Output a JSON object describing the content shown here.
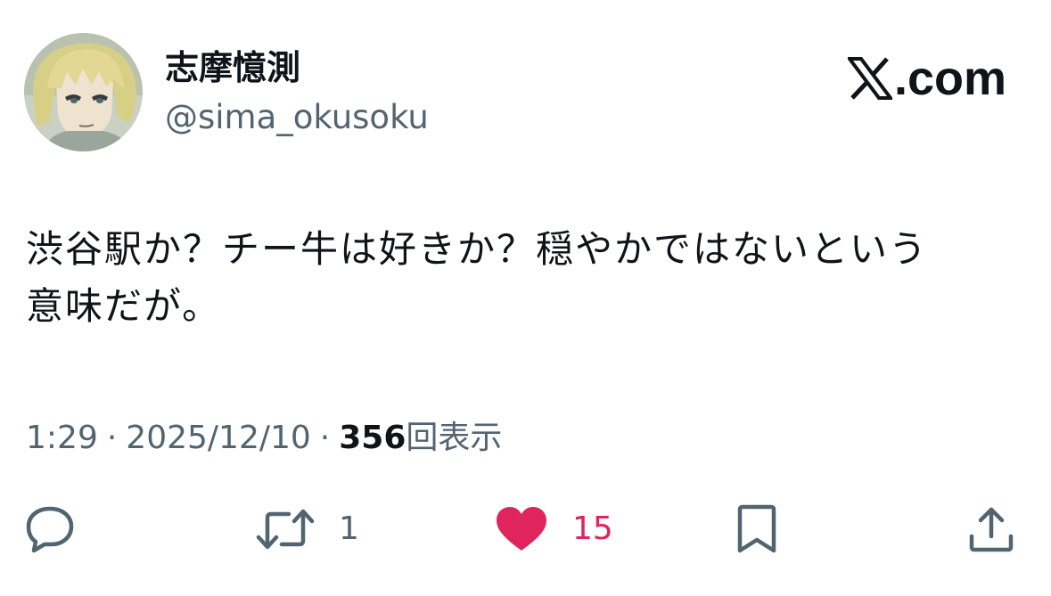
{
  "user": {
    "display_name": "志摩憶測",
    "handle": "@sima_okusoku",
    "avatar_icon": "avatar-anime-character"
  },
  "brand": {
    "text": ".com",
    "icon": "x-logo-icon"
  },
  "tweet": {
    "text_line1": "渋谷駅か？チー牛は好きか？穏やかではないという",
    "text_line2": "意味だが。"
  },
  "meta": {
    "time": "1:29",
    "date": "2025/12/10",
    "separator": "·",
    "views_count": "356",
    "views_label": "回表示"
  },
  "actions": {
    "reply_icon": "reply-icon",
    "retweet_icon": "retweet-icon",
    "retweet_count": "1",
    "like_icon": "heart-icon",
    "like_count": "15",
    "bookmark_icon": "bookmark-icon",
    "share_icon": "share-icon"
  },
  "colors": {
    "text_primary": "#0f1419",
    "text_secondary": "#536471",
    "like_active": "#e0245e"
  }
}
